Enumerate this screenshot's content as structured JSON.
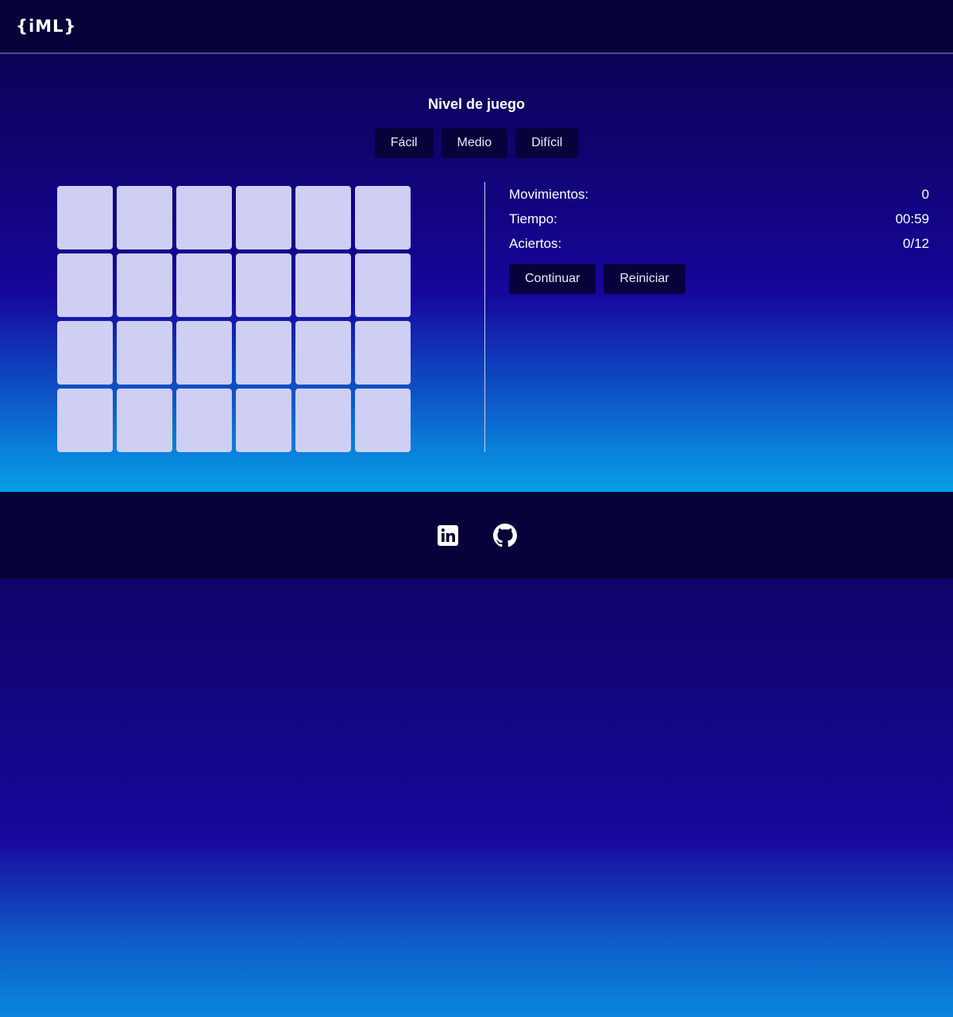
{
  "header": {
    "logo": "{iML}"
  },
  "game": {
    "level_title": "Nivel de juego",
    "levels": [
      "Fácil",
      "Medio",
      "Difícil"
    ],
    "grid": {
      "rows": 4,
      "columns": 6
    }
  },
  "stats": {
    "moves_label": "Movimientos:",
    "moves_value": "0",
    "time_label": "Tiempo:",
    "time_value": "00:59",
    "hits_label": "Aciertos:",
    "hits_value": "0/12",
    "continue_label": "Continuar",
    "restart_label": "Reiniciar"
  },
  "footer": {
    "links": [
      "linkedin-icon",
      "github-icon"
    ]
  },
  "colors": {
    "card": "#cfcff3",
    "button_bg": "#07023a",
    "header_bg": "#07023a",
    "text": "#ffffff"
  }
}
